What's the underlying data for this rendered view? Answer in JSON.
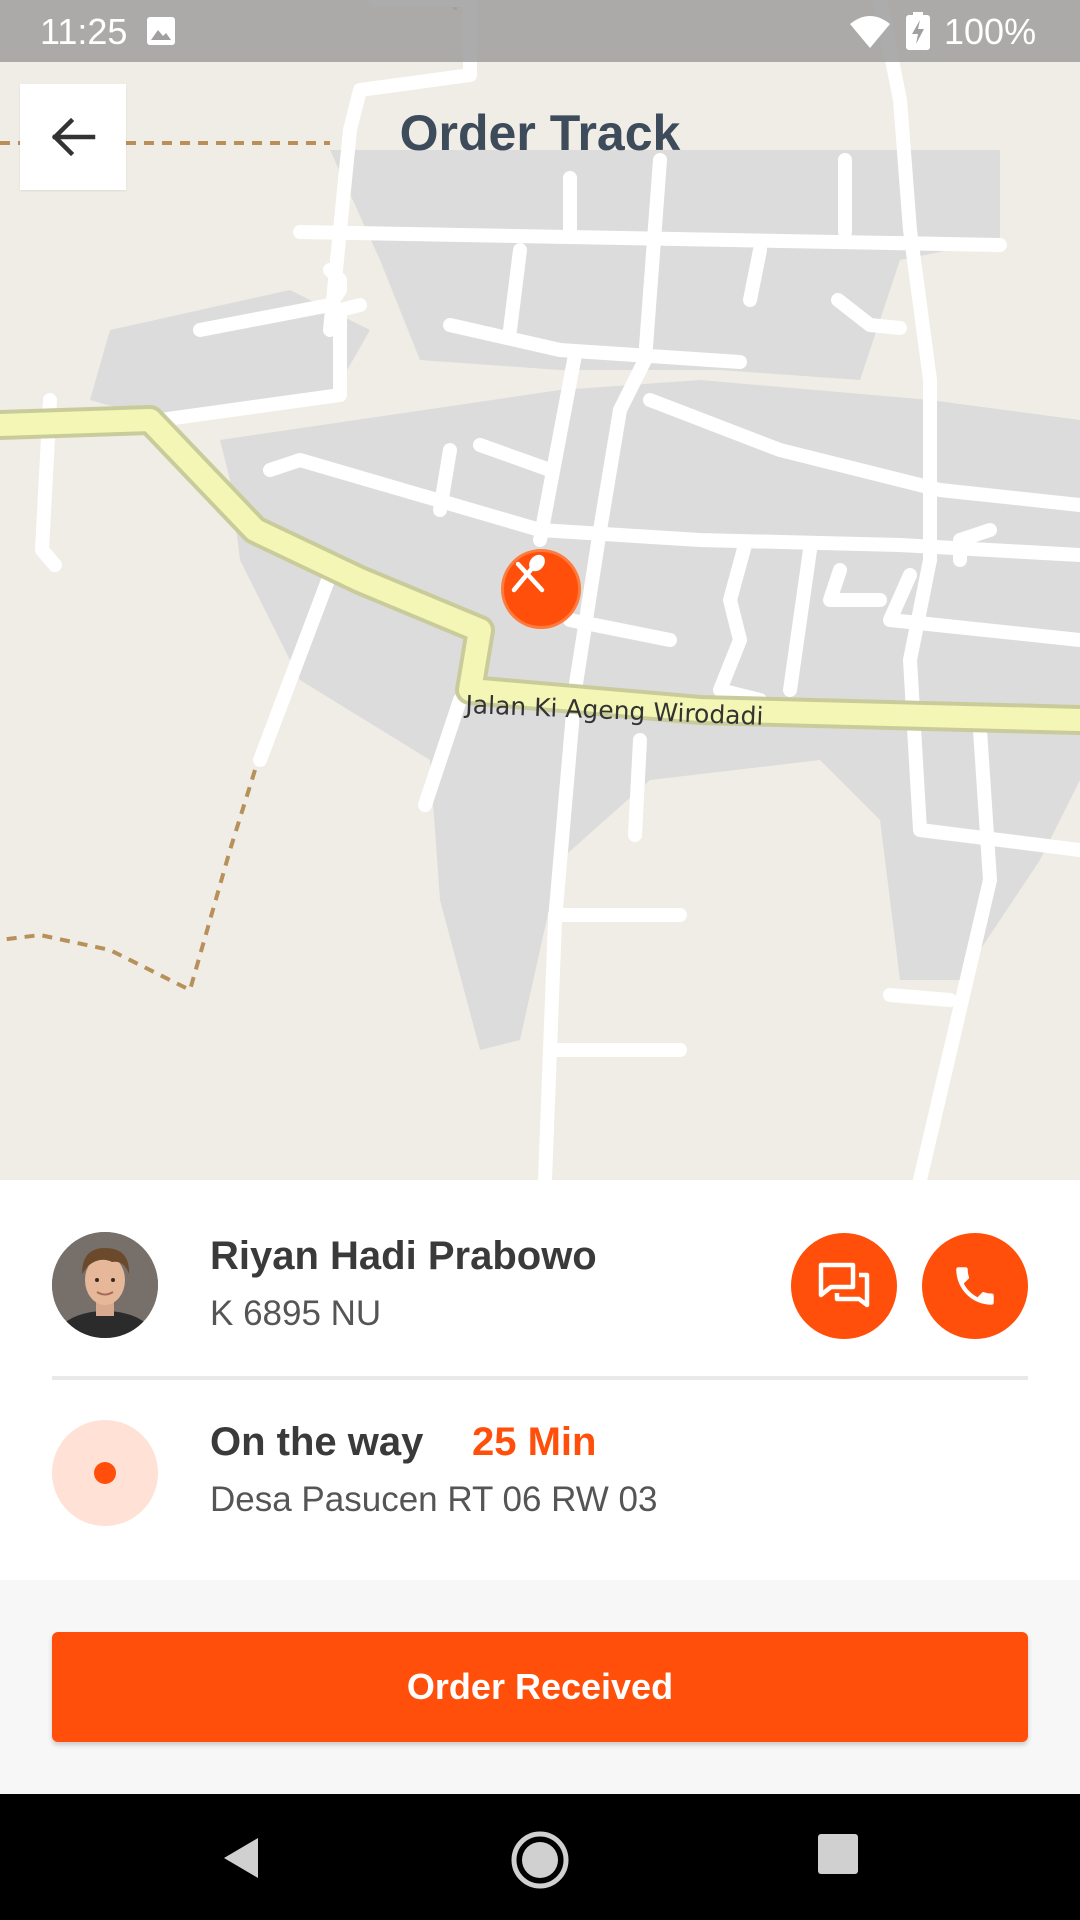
{
  "status_bar": {
    "time": "11:25",
    "battery": "100%",
    "icons": [
      "image-icon",
      "wifi-icon",
      "battery-charging-icon"
    ]
  },
  "header": {
    "title": "Order Track",
    "back_icon": "arrow-left-icon"
  },
  "map": {
    "street_label": "Jalan Ki Ageng Wirodadi",
    "marker_icon": "utensils-icon",
    "marker_color": "#ff4f0a"
  },
  "driver": {
    "name": "Riyan Hadi Prabowo",
    "plate": "K 6895 NU",
    "chat_icon": "chat-icon",
    "call_icon": "phone-icon"
  },
  "trip": {
    "status": "On the way",
    "eta": "25 Min",
    "address": "Desa Pasucen RT 06 RW 03"
  },
  "actions": {
    "order_received_label": "Order Received"
  },
  "colors": {
    "accent": "#ff4f0a",
    "accent_light": "#ffe1d6",
    "title": "#3d4b5a"
  }
}
